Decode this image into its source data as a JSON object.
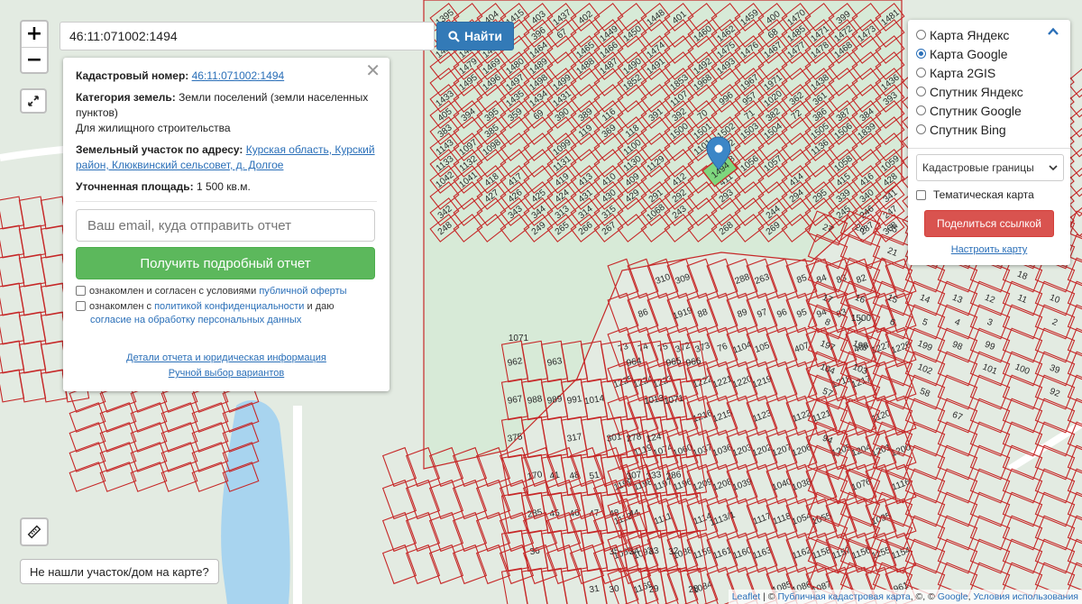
{
  "search": {
    "query": "46:11:071002:1494",
    "button_label": "Найти"
  },
  "zoom": {
    "in_label": "+",
    "out_label": "−"
  },
  "info": {
    "cadastral_label": "Кадастровый номер:",
    "cadastral_value": "46:11:071002:1494",
    "category_label": "Категория земель:",
    "category_value": "Земли поселений (земли населенных пунктов)",
    "use_value": "Для жилищного строительства",
    "address_label": "Земельный участок по адресу:",
    "address_value": "Курская область, Курский район, Клюквинский сельсовет, д. Долгое",
    "area_label": "Уточненная площадь:",
    "area_value": "1 500 кв.м.",
    "email_placeholder": "Ваш email, куда отправить отчет",
    "report_button": "Получить подробный отчет",
    "agree1_text": "ознакомлен и согласен с условиями",
    "agree1_link": "публичной оферты",
    "agree2_text_a": "ознакомлен с",
    "agree2_link1": "политикой конфиденциальности",
    "agree2_text_b": "и даю",
    "agree2_link2": "согласие на обработку персональных данных",
    "details_link": "Детали отчета и юридическая информация",
    "manual_link": "Ручной выбор вариантов"
  },
  "layers": {
    "options": [
      {
        "label": "Карта Яндекс",
        "checked": false
      },
      {
        "label": "Карта Google",
        "checked": true
      },
      {
        "label": "Карта 2GIS",
        "checked": false
      },
      {
        "label": "Спутник Яндекс",
        "checked": false
      },
      {
        "label": "Спутник Google",
        "checked": false
      },
      {
        "label": "Спутник Bing",
        "checked": false
      }
    ],
    "select_value": "Кадастровые границы",
    "thematic_label": "Тематическая карта",
    "share_button": "Поделиться ссылкой",
    "configure_link": "Настроить карту"
  },
  "notfound_button": "Не нашли участок/дом на карте?",
  "attribution": {
    "leaflet": "Leaflet",
    "sep1": " | © ",
    "pkk": "Публичная кадастровая карта",
    "sep2": ", ©, © ",
    "google": "Google",
    "sep3": ", ",
    "terms": "Условия использования"
  },
  "map": {
    "parcel_stroke": "#c62828",
    "land_color": "#e3ebe2",
    "field_color": "#d7ead7",
    "water_color": "#a8d4ef",
    "selected_color": "#7ed67e",
    "selected_parcel": "1494",
    "big_parcel_labels": [
      "1071",
      "1500"
    ],
    "parcel_labels": [
      "1395",
      "404",
      "1415",
      "403",
      "1437",
      "402",
      "1448",
      "401",
      "1459",
      "400",
      "1470",
      "399",
      "1481",
      "398",
      "397",
      "396",
      "67",
      "1449",
      "1450",
      "1460",
      "1462",
      "68",
      "1485",
      "1471",
      "1472",
      "1473",
      "1482",
      "1483",
      "1463",
      "1464",
      "1465",
      "1466",
      "1474",
      "1475",
      "1476",
      "1467",
      "1477",
      "1478",
      "1468",
      "1479",
      "1469",
      "1480",
      "1489",
      "1488",
      "1487",
      "1490",
      "1491",
      "1492",
      "1493",
      "1495",
      "1496",
      "1497",
      "1498",
      "1499",
      "1852",
      "1853",
      "1968",
      "1967",
      "1971",
      "1438",
      "1436",
      "1433",
      "1435",
      "1434",
      "1431",
      "1107",
      "996",
      "957",
      "1020",
      "362",
      "361",
      "393",
      "405",
      "394",
      "395",
      "359",
      "69",
      "390",
      "389",
      "116",
      "391",
      "392",
      "70",
      "71",
      "382",
      "72",
      "386",
      "387",
      "384",
      "383",
      "385",
      "119",
      "369",
      "118",
      "1500",
      "1501",
      "1502",
      "1503",
      "1504",
      "1505",
      "1506",
      "1839",
      "1143",
      "1097",
      "1098",
      "1099",
      "1100",
      "1101",
      "1102",
      "1136",
      "1133",
      "1132",
      "1131",
      "1130",
      "1129",
      "1138",
      "1056",
      "1057",
      "1058",
      "1059",
      "1042",
      "1041",
      "418",
      "417",
      "419",
      "413",
      "410",
      "409",
      "412",
      "411",
      "414",
      "415",
      "416",
      "428",
      "427",
      "426",
      "425",
      "424",
      "431",
      "430",
      "429",
      "291",
      "292",
      "293",
      "294",
      "295",
      "339",
      "340",
      "341",
      "342",
      "343",
      "344",
      "313",
      "314",
      "315",
      "1068",
      "243",
      "244",
      "245",
      "246",
      "247",
      "248",
      "249",
      "265",
      "266",
      "267",
      "268",
      "269",
      "287",
      "308",
      "310",
      "309",
      "288",
      "263",
      "85",
      "84",
      "83",
      "82",
      "86",
      "1919",
      "88",
      "89",
      "97",
      "96",
      "95",
      "94",
      "93",
      "73",
      "74",
      "75",
      "372",
      "373",
      "76",
      "1104",
      "105",
      "407",
      "408",
      "1227",
      "1226",
      "1225",
      "1224",
      "1223",
      "1222",
      "1221",
      "1220",
      "1219",
      "1218",
      "1217",
      "1216",
      "1215",
      "1123",
      "1122",
      "1121",
      "1120",
      "1119",
      "1074",
      "1060",
      "1037",
      "1036",
      "1203",
      "1202",
      "1207",
      "1206",
      "1205",
      "1204",
      "1201",
      "1200",
      "1199",
      "1198",
      "1197",
      "1196",
      "1209",
      "1208",
      "1039",
      "1040",
      "1038",
      "1076",
      "1116",
      "1112",
      "1111",
      "1114",
      "1113/1",
      "1117",
      "1118",
      "1054",
      "1055",
      "1035",
      "1089",
      "1092",
      "1088",
      "1159",
      "1161",
      "1160",
      "1163",
      "1162",
      "1158",
      "1157",
      "1156",
      "1155",
      "1154",
      "1169",
      "1084",
      "1085",
      "1086",
      "1087",
      "961",
      "962",
      "963",
      "964",
      "965",
      "966",
      "967",
      "988",
      "989",
      "991",
      "1014",
      "1013",
      "1071",
      "375",
      "317",
      "301",
      "278",
      "124",
      "170",
      "41",
      "48",
      "51",
      "307",
      "333",
      "286",
      "285",
      "45",
      "46",
      "47",
      "48",
      "44",
      "36",
      "35",
      "34",
      "33",
      "32",
      "31",
      "30",
      "29",
      "28",
      "27",
      "26",
      "25",
      "24",
      "23",
      "22",
      "21",
      "20",
      "19",
      "18",
      "17",
      "16",
      "15",
      "14",
      "13",
      "12",
      "11",
      "10",
      "9",
      "8",
      "7",
      "6",
      "5",
      "4",
      "3",
      "2",
      "1",
      "197",
      "198",
      "199",
      "98",
      "99",
      "104",
      "103",
      "102",
      "101",
      "100",
      "39",
      "56",
      "57",
      "58",
      "92",
      "67",
      "94"
    ]
  }
}
